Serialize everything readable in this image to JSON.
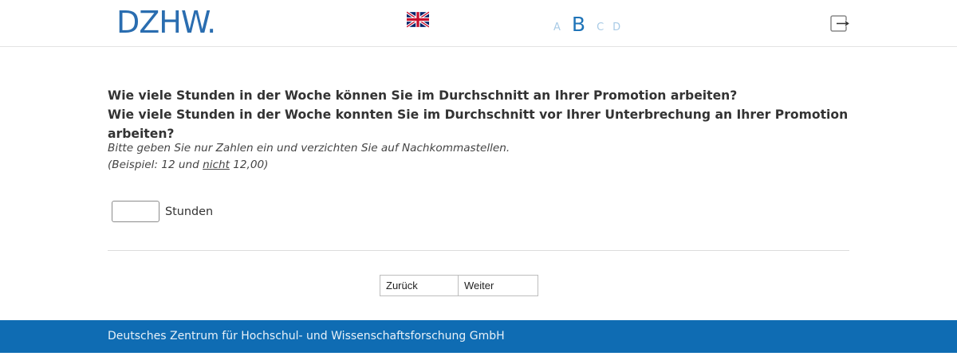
{
  "header": {
    "logo_text": "DZHW.",
    "language_flag": "uk-flag-icon",
    "font_sizes": [
      "A",
      "B",
      "C",
      "D"
    ],
    "logout_icon": "logout-icon"
  },
  "question": {
    "line1": "Wie viele Stunden in der Woche können Sie im Durchschnitt an Ihrer Promotion arbeiten?",
    "line2": "Wie viele Stunden in der Woche konnten Sie im Durchschnitt vor Ihrer Unterbrechung an Ihrer Promotion arbeiten?"
  },
  "hint": {
    "line1": "Bitte geben Sie nur Zahlen ein und verzichten Sie auf Nachkommastellen.",
    "line2_pre": "(Beispiel: 12 und ",
    "line2_underlined": "nicht",
    "line2_post": " 12,00)"
  },
  "answer": {
    "value": "",
    "unit": "Stunden"
  },
  "navigation": {
    "back_label": "Zurück",
    "next_label": "Weiter"
  },
  "footer": {
    "text": "Deutsches Zentrum für Hochschul- und Wissenschaftsforschung GmbH"
  },
  "colors": {
    "brand": "#2a6db0",
    "footer_bg": "#0f6cb3",
    "fontsize_inactive": "#a9cbe6",
    "fontsize_active": "#1f74b8"
  }
}
